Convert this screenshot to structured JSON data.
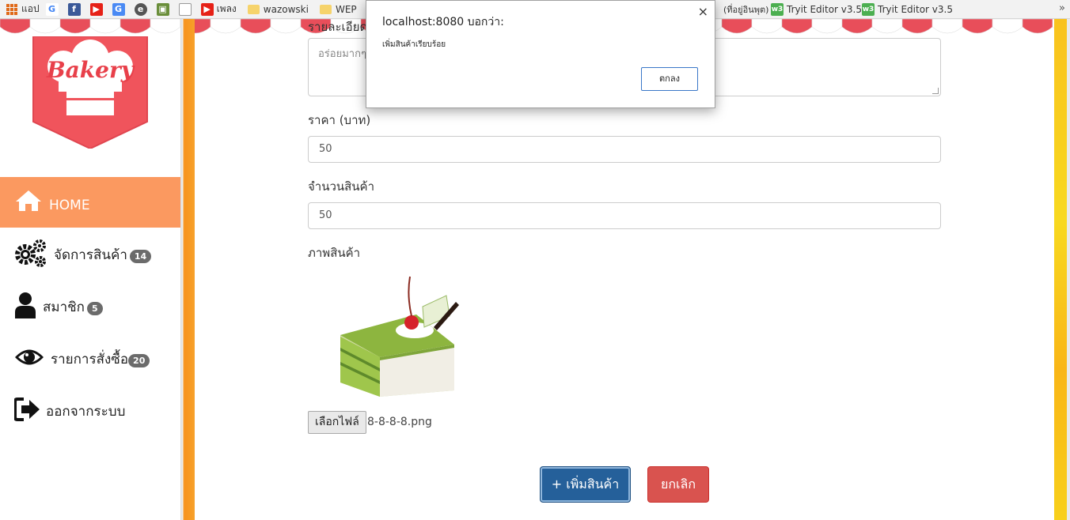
{
  "bookmarks": {
    "items": [
      {
        "label": "แอป",
        "icon": "apps-grid-icon"
      },
      {
        "label": "",
        "icon": "google-icon"
      },
      {
        "label": "",
        "icon": "facebook-icon"
      },
      {
        "label": "",
        "icon": "youtube-icon"
      },
      {
        "label": "",
        "icon": "translate-icon"
      },
      {
        "label": "",
        "icon": "edge-icon"
      },
      {
        "label": "",
        "icon": "app-icon"
      },
      {
        "label": "",
        "icon": "page-icon"
      },
      {
        "label": "เพลง",
        "icon": "youtube-icon"
      },
      {
        "label": "wazowski",
        "icon": "folder-icon"
      },
      {
        "label": "WEP",
        "icon": "folder-icon"
      },
      {
        "label": "(ที่อยู่อินพุต)",
        "icon": "none"
      },
      {
        "label": "Tryit Editor v3.5",
        "icon": "w3schools-icon"
      },
      {
        "label": "Tryit Editor v3.5",
        "icon": "w3schools-icon"
      }
    ],
    "more": "»"
  },
  "sidebar": {
    "logo_text": "Bakery",
    "items": [
      {
        "label": "HOME",
        "icon": "home-icon",
        "badge": ""
      },
      {
        "label": "จัดการสินค้า",
        "icon": "gears-icon",
        "badge": "14"
      },
      {
        "label": "สมาชิก",
        "icon": "user-icon",
        "badge": "5"
      },
      {
        "label": "รายการสั่งซื้อ",
        "icon": "eye-icon",
        "badge": "20"
      },
      {
        "label": "ออกจากระบบ",
        "icon": "sign-out-icon",
        "badge": ""
      }
    ]
  },
  "form": {
    "description_label": "รายละเอียดสินค้า",
    "description_value": "อร่อยมากๆ",
    "price_label": "ราคา (บาท)",
    "price_value": "50",
    "qty_label": "จำนวนสินค้า",
    "qty_value": "50",
    "image_label": "ภาพสินค้า",
    "file_button": "เลือกไฟล์",
    "file_name": "8-8-8-8.png",
    "submit_label": "+ เพิ่มสินค้า",
    "cancel_label": "ยกเลิก"
  },
  "dialog": {
    "title": "localhost:8080 บอกว่า:",
    "message": "เพิ่มสินค้าเรียบร้อย",
    "ok_label": "ตกลง",
    "close": "×"
  },
  "colors": {
    "active_nav": "#fb9960",
    "primary_button": "#25609a",
    "danger_button": "#d9534f",
    "awning_red": "#e84e5a",
    "orange_border": "#f7931e"
  }
}
